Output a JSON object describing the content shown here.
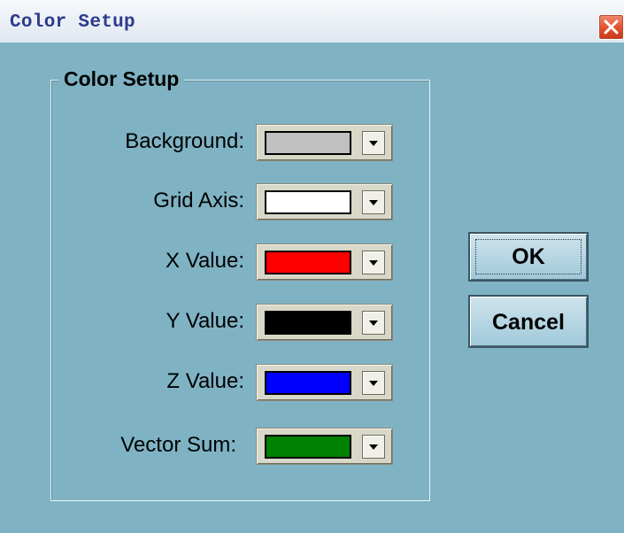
{
  "window": {
    "title": "Color Setup"
  },
  "group": {
    "title": "Color Setup"
  },
  "rows": [
    {
      "label": "Background:",
      "color": "#c0c0c0"
    },
    {
      "label": "Grid Axis:",
      "color": "#ffffff"
    },
    {
      "label": "X Value:",
      "color": "#ff0000"
    },
    {
      "label": "Y Value:",
      "color": "#000000"
    },
    {
      "label": "Z Value:",
      "color": "#0000ff"
    },
    {
      "label": "Vector Sum:",
      "color": "#008000"
    }
  ],
  "buttons": {
    "ok": "OK",
    "cancel": "Cancel"
  },
  "icons": {
    "close": "close-icon",
    "dropdown": "chevron-down-icon"
  },
  "theme": {
    "client_bg": "#7fb3c4",
    "title_text": "#2b3b8c",
    "close_bg": "#e0512e"
  }
}
